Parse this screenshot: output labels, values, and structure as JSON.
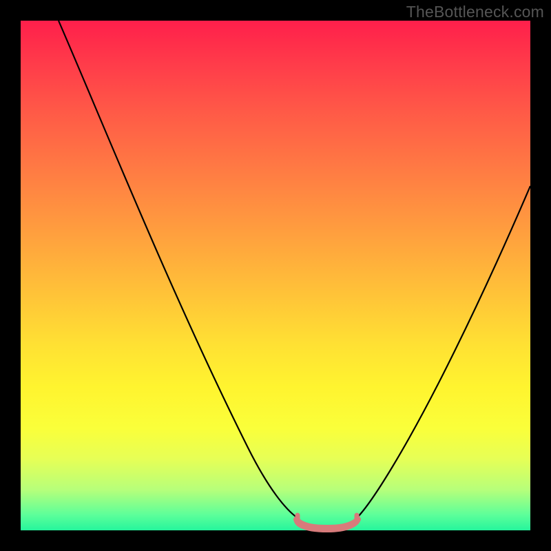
{
  "watermark": "TheBottleneck.com",
  "chart_data": {
    "type": "line",
    "title": "",
    "xlabel": "",
    "ylabel": "",
    "xlim": [
      0,
      100
    ],
    "ylim": [
      0,
      100
    ],
    "series": [
      {
        "name": "bottleneck-curve",
        "x": [
          8,
          15,
          25,
          35,
          45,
          52,
          55,
          58,
          62,
          65,
          68,
          72,
          80,
          90,
          100
        ],
        "y": [
          100,
          85,
          64,
          43,
          22,
          8,
          2,
          0.5,
          0.5,
          2,
          8,
          18,
          35,
          53,
          70
        ]
      },
      {
        "name": "highlight-band",
        "x": [
          55,
          58,
          62,
          65
        ],
        "y": [
          2,
          0.5,
          0.5,
          2
        ]
      }
    ],
    "colors": {
      "gradient_top": "#ff1f4b",
      "gradient_mid": "#ffe233",
      "gradient_bottom": "#25f59c",
      "curve": "#000000",
      "highlight": "#d77b7b"
    }
  }
}
